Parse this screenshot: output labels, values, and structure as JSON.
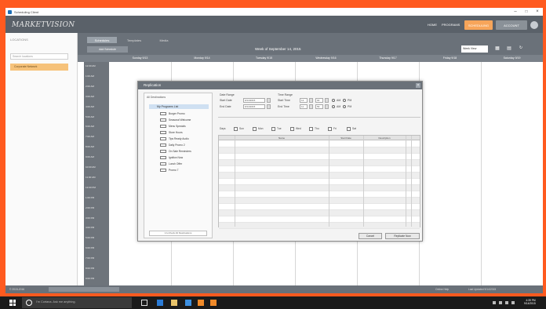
{
  "window": {
    "title": "Scheduling Client"
  },
  "header": {
    "logo": "MARKETVISION",
    "nav": [
      "HOME",
      "PROGRAMS"
    ],
    "highlight_button": "SCHEDULING",
    "user_button": "ACCOUNT"
  },
  "sidebar": {
    "heading": "LOCATIONS",
    "search_placeholder": "Search locations",
    "selected_item": "Corporate Network"
  },
  "toolbar": {
    "tabs": [
      "Schedules",
      "Templates",
      "Media"
    ],
    "action_button": "Add Schedule",
    "week_title": "Week of September 14, 2015",
    "view_select": "Week View",
    "icons": [
      "grid-icon",
      "calendar-icon"
    ]
  },
  "calendar": {
    "day_headers": [
      "Sunday 9/13",
      "Monday 9/14",
      "Tuesday 9/15",
      "Wednesday 9/16",
      "Thursday 9/17",
      "Friday 9/18",
      "Saturday 9/19"
    ],
    "times": [
      "12:00 AM",
      "1:00 AM",
      "2:00 AM",
      "3:00 AM",
      "4:00 AM",
      "5:00 AM",
      "6:00 AM",
      "7:00 AM",
      "8:00 AM",
      "9:00 AM",
      "10:00 AM",
      "11:00 AM",
      "12:00 PM",
      "1:00 PM",
      "2:00 PM",
      "3:00 PM",
      "4:00 PM",
      "5:00 PM",
      "6:00 PM",
      "7:00 PM",
      "8:00 PM",
      "9:00 PM"
    ]
  },
  "modal": {
    "title": "Replication",
    "tree_heading": "All Destinations",
    "tree_root": "My Programs List",
    "tree_items": [
      "Burger Promo",
      "Seasonal Welcome",
      "Menu Specials",
      "Store Hours",
      "Tips Ready Audio",
      "Daily Promo 2",
      "On Sale Reminders",
      "Ignition Now",
      "Lunch Offer",
      "Promo 7"
    ],
    "tree_button": "Un-Check All Destinations",
    "date_range_label": "Date Range",
    "start_date_label": "Start Date",
    "end_date_label": "End Date",
    "start_date": "9/14/2015",
    "end_date": "9/14/2015",
    "time_range_label": "Time Range",
    "start_time_label": "Start Time",
    "end_time_label": "End Time",
    "start_hour": "12",
    "start_min": "00",
    "end_hour": "11",
    "end_min": "59",
    "am_label": "AM",
    "pm_label": "PM",
    "days_label": "Days",
    "days": [
      "Sun",
      "Mon",
      "Tue",
      "Wed",
      "Thu",
      "Fri",
      "Sat"
    ],
    "grid_headers": [
      "Name",
      "Start Date",
      "Description"
    ],
    "cancel_button": "Cancel",
    "submit_button": "Replicate Now"
  },
  "statusbar": {
    "left_text": "© 2015-2016",
    "right_text_1": "Online Help",
    "right_text_2": "Last Updated 9/14/2015"
  },
  "taskbar": {
    "search_text": "I'm Cortana. Ask me anything.",
    "time": "4:39 PM",
    "date": "9/14/2015"
  }
}
